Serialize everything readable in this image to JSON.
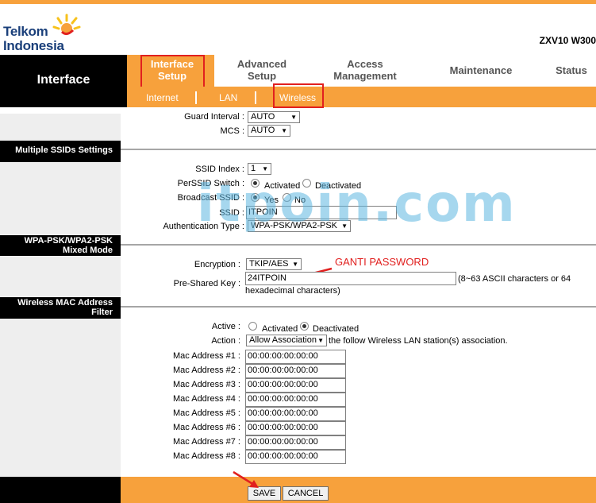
{
  "brand": {
    "line1": "Telkom",
    "line2": "Indonesia"
  },
  "model": "ZXV10 W300",
  "left_title": "Interface",
  "nav": [
    {
      "line1": "Interface",
      "line2": "Setup"
    },
    {
      "line1": "Advanced",
      "line2": "Setup"
    },
    {
      "line1": "Access",
      "line2": "Management"
    },
    {
      "line1": "Maintenance",
      "line2": ""
    },
    {
      "line1": "Status",
      "line2": ""
    }
  ],
  "subnav": [
    "Internet",
    "LAN",
    "Wireless"
  ],
  "top_fields": {
    "guard_interval_label": "Guard Interval :",
    "guard_interval_value": "AUTO",
    "mcs_label": "MCS :",
    "mcs_value": "AUTO"
  },
  "sections": {
    "multi_ssid": "Multiple SSIDs Settings",
    "wpa": "WPA-PSK/WPA2-PSK Mixed Mode",
    "mac_filter": "Wireless MAC Address Filter"
  },
  "ssid": {
    "index_label": "SSID Index :",
    "index_value": "1",
    "switch_label": "PerSSID Switch :",
    "activated": "Activated",
    "deactivated": "Deactivated",
    "broadcast_label": "Broadcast SSID :",
    "yes": "Yes",
    "no": "No",
    "ssid_label": "SSID :",
    "ssid_value": "ITPOIN",
    "auth_label": "Authentication Type :",
    "auth_value": "WPA-PSK/WPA2-PSK"
  },
  "wpa": {
    "enc_label": "Encryption :",
    "enc_value": "TKIP/AES",
    "psk_label": "Pre-Shared Key :",
    "psk_value": "24ITPOIN",
    "psk_hint1": "(8~63 ASCII characters or 64",
    "psk_hint2": "hexadecimal characters)"
  },
  "annotation": "GANTI PASSWORD",
  "watermark": "itpoin.com",
  "mac": {
    "active_label": "Active :",
    "activated": "Activated",
    "deactivated": "Deactivated",
    "action_label": "Action :",
    "action_value": "Allow Association",
    "action_suffix": "the follow Wireless LAN station(s) association.",
    "entries": [
      {
        "label": "Mac Address #1 :",
        "value": "00:00:00:00:00:00"
      },
      {
        "label": "Mac Address #2 :",
        "value": "00:00:00:00:00:00"
      },
      {
        "label": "Mac Address #3 :",
        "value": "00:00:00:00:00:00"
      },
      {
        "label": "Mac Address #4 :",
        "value": "00:00:00:00:00:00"
      },
      {
        "label": "Mac Address #5 :",
        "value": "00:00:00:00:00:00"
      },
      {
        "label": "Mac Address #6 :",
        "value": "00:00:00:00:00:00"
      },
      {
        "label": "Mac Address #7 :",
        "value": "00:00:00:00:00:00"
      },
      {
        "label": "Mac Address #8 :",
        "value": "00:00:00:00:00:00"
      }
    ]
  },
  "buttons": {
    "save": "SAVE",
    "cancel": "CANCEL"
  },
  "colors": {
    "orange": "#f7a13c",
    "annotation_red": "#e1201f",
    "brand_blue": "#1a3f7a",
    "watermark": "#5cb6e0"
  }
}
